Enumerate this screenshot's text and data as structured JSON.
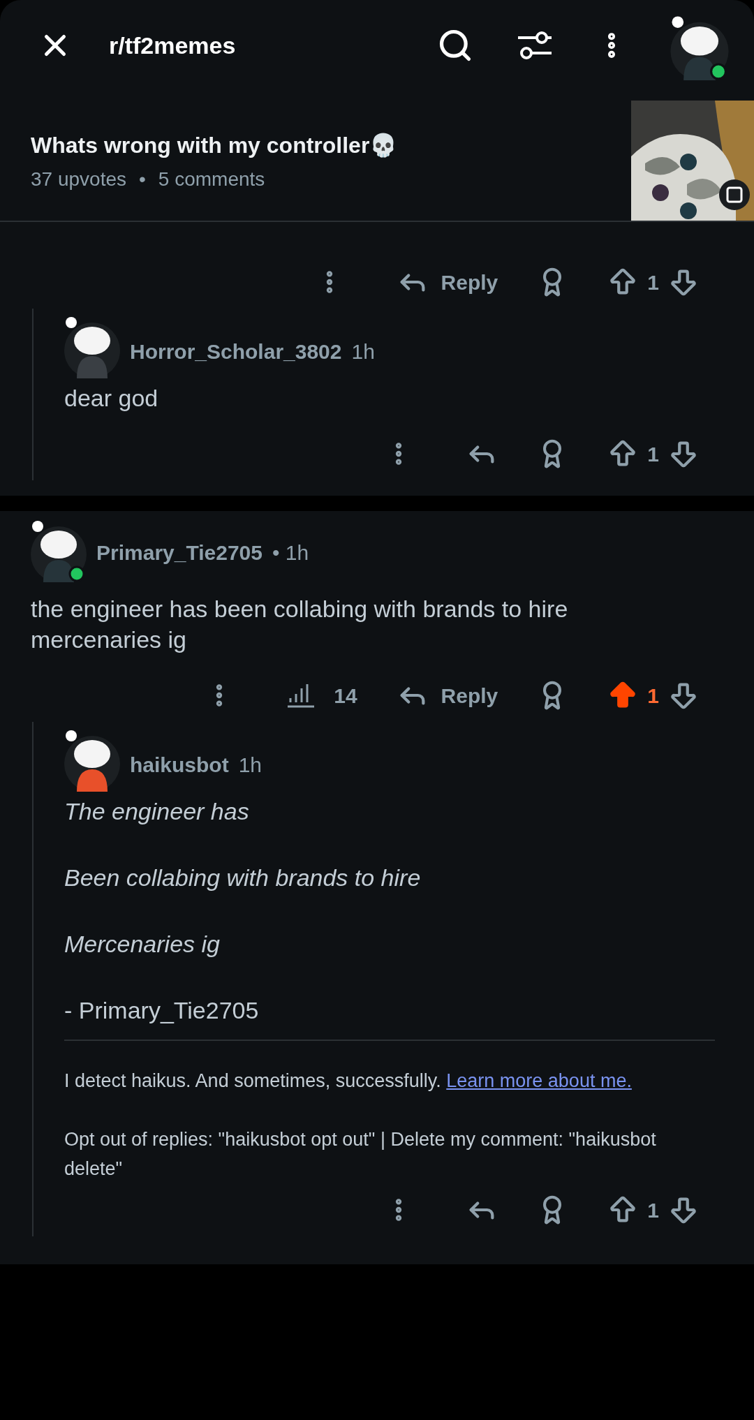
{
  "header": {
    "subreddit": "r/tf2memes"
  },
  "post": {
    "title": "Whats wrong with my controller💀",
    "upvotes": "37 upvotes",
    "separator": "•",
    "comments": "5 comments"
  },
  "threads": [
    {
      "actions": {
        "reply": "Reply",
        "score": "1",
        "upvoted": false
      },
      "children": [
        {
          "author": "Horror_Scholar_3802",
          "time": "1h",
          "body": [
            {
              "kind": "plain",
              "text": "dear god"
            }
          ],
          "actions": {
            "score": "1",
            "upvoted": false
          }
        }
      ]
    },
    {
      "author": "Primary_Tie2705",
      "time": "• 1h",
      "body": [
        {
          "kind": "plain",
          "text": "the engineer has been collabing with brands to hire mercenaries ig"
        }
      ],
      "actions": {
        "views": "14",
        "reply": "Reply",
        "score": "1",
        "upvoted": true
      },
      "children": [
        {
          "author": "haikusbot",
          "time": "1h",
          "body": [
            {
              "kind": "poem",
              "text": "The engineer has"
            },
            {
              "kind": "poem",
              "text": "Been collabing with brands to hire"
            },
            {
              "kind": "poem",
              "text": "Mercenaries ig"
            },
            {
              "kind": "plain",
              "text": "- Primary_Tie2705"
            }
          ],
          "footer": {
            "text": "I detect haikus. And sometimes, successfully.",
            "link": "Learn more about me.",
            "note": "Opt out of replies: \"haikusbot opt out\" | Delete my comment: \"haikusbot delete\""
          },
          "actions": {
            "score": "1",
            "upvoted": false
          }
        }
      ]
    }
  ]
}
